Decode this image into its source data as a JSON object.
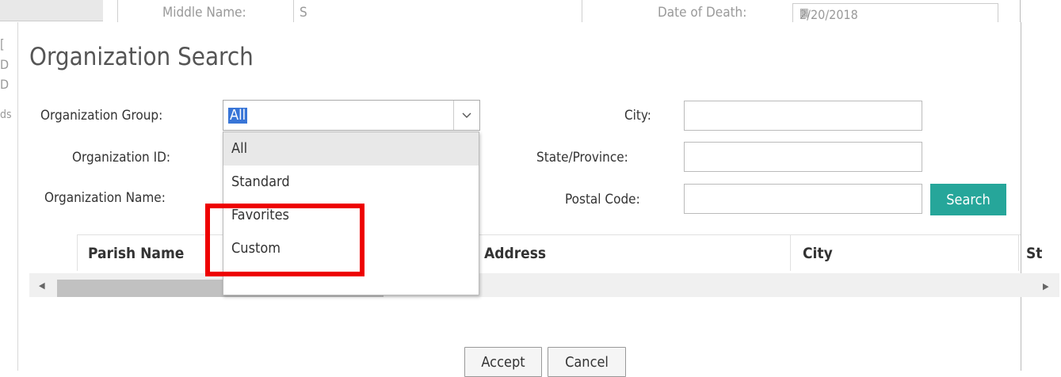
{
  "background": {
    "middle_name_label": "Middle Name:",
    "middle_name_value": "S",
    "date_of_death_label": "Date of Death:",
    "date_of_death_value": "2/20/2018",
    "left_frags": [
      "[",
      "D",
      "D",
      "ds"
    ]
  },
  "dialog": {
    "title": "Organization Search",
    "fields": {
      "org_group_label": "Organization Group:",
      "org_group_value": "All",
      "org_id_label": "Organization ID:",
      "org_name_label": "Organization Name:",
      "city_label": "City:",
      "state_label": "State/Province:",
      "postal_label": "Postal Code:"
    },
    "dropdown_options": [
      "All",
      "Standard",
      "Favorites",
      "Custom"
    ],
    "selected_option": "All",
    "search_button": "Search",
    "columns": [
      "Parish Name",
      "Address",
      "City",
      "St"
    ],
    "accept_button": "Accept",
    "cancel_button": "Cancel"
  },
  "colors": {
    "search_button": "#26a69a",
    "highlight": "#ee0000",
    "selection": "#3875d7"
  }
}
